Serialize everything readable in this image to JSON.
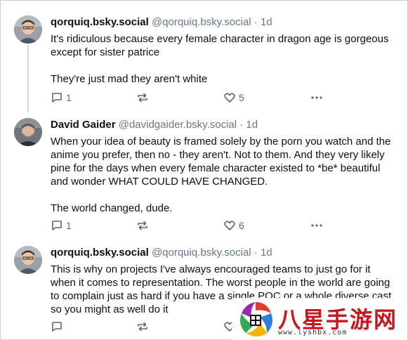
{
  "posts": [
    {
      "name": "qorquiq.bsky.social",
      "handle": "@qorquiq.bsky.social",
      "time": "· 1d",
      "paragraphs": [
        "It's ridiculous because every female character in dragon age is gorgeous except for sister patrice",
        "They're just mad they aren't white"
      ],
      "replies": "1",
      "reposts": "",
      "likes": "5"
    },
    {
      "name": "David Gaider",
      "handle": "@davidgaider.bsky.social",
      "time": "· 1d",
      "paragraphs": [
        "When your idea of beauty is framed solely by the porn you watch and the anime you prefer, then no - they aren't. Not to them. And they very likely pine for the days when every female character existed to *be* beautiful and wonder WHAT COULD HAVE CHANGED.",
        "The world changed, dude."
      ],
      "replies": "1",
      "reposts": "",
      "likes": "6"
    },
    {
      "name": "qorquiq.bsky.social",
      "handle": "@qorquiq.bsky.social",
      "time": "· 1d",
      "paragraphs": [
        "This is why on projects I've always encouraged teams to just go for it when it comes to representation. The worst people in the world are going to complain just as hard if you have a single POC or a whole diverse cast, so you might as well do it"
      ],
      "replies": "",
      "reposts": "",
      "likes": ""
    }
  ],
  "watermark": {
    "title": "八星手游网",
    "url": "www.lyshbx.com"
  },
  "colors": {
    "text": "#0b0f14",
    "muted": "#6b7785",
    "thread_line": "#d4d9de",
    "watermark_red": "#c8161d"
  }
}
